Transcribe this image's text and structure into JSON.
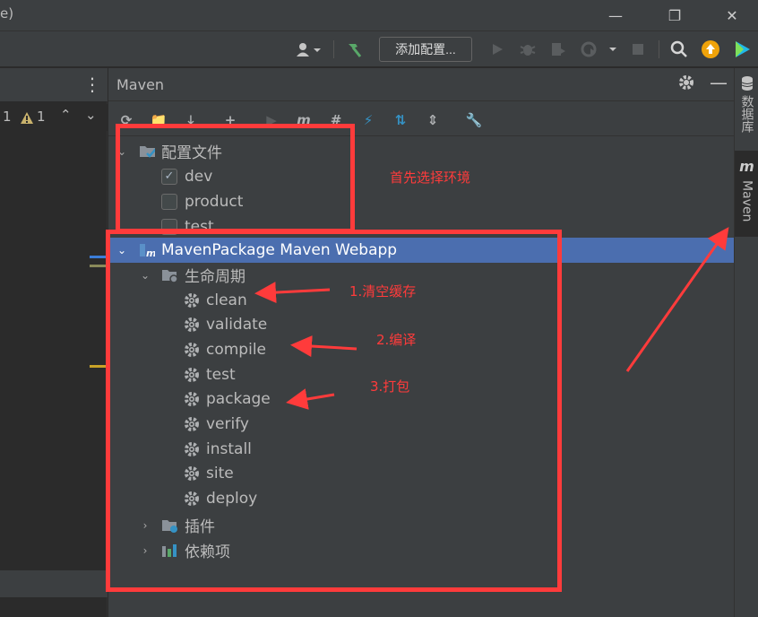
{
  "titlebar": {
    "title_fragment": "e)"
  },
  "toolbar": {
    "add_config_label": "添加配置..."
  },
  "editor": {
    "error_count": "1",
    "warning_count": "1"
  },
  "maven": {
    "title": "Maven",
    "profiles": {
      "label": "配置文件",
      "items": [
        {
          "label": "dev",
          "checked": true
        },
        {
          "label": "product",
          "checked": false
        },
        {
          "label": "test",
          "checked": false
        }
      ]
    },
    "project": {
      "label": "MavenPackage Maven Webapp",
      "lifecycle": {
        "label": "生命周期",
        "goals": [
          "clean",
          "validate",
          "compile",
          "test",
          "package",
          "verify",
          "install",
          "site",
          "deploy"
        ]
      },
      "plugins_label": "插件",
      "dependencies_label": "依赖项"
    }
  },
  "right_strip": {
    "database_tab": "数据库",
    "maven_tab": "Maven"
  },
  "annotations": {
    "choose_env": "首先选择环境",
    "step1": "1.清空缓存",
    "step2": "2.编译",
    "step3": "3.打包"
  },
  "colors": {
    "annotation_red": "#ff3b3b",
    "selection_blue": "#4b6eaf",
    "panel_bg": "#3c3f41"
  }
}
